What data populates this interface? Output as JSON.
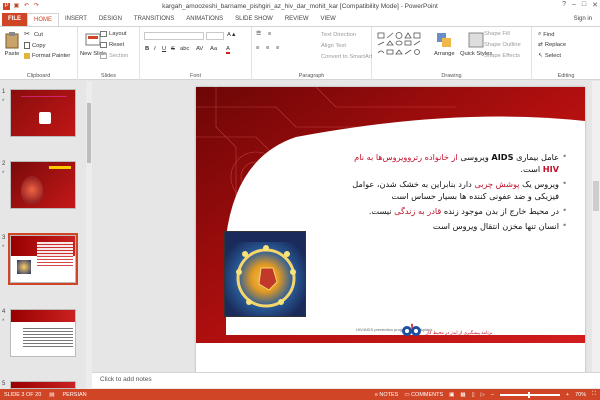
{
  "window": {
    "title": "kargah_amoozeshi_barname_pishgiri_az_hiv_dar_mohit_kar [Compatibility Mode] - PowerPoint",
    "signin": "Sign in"
  },
  "tabs": [
    "FILE",
    "HOME",
    "INSERT",
    "DESIGN",
    "TRANSITIONS",
    "ANIMATIONS",
    "SLIDE SHOW",
    "REVIEW",
    "VIEW"
  ],
  "ribbon": {
    "clipboard": {
      "label": "Clipboard",
      "paste": "Paste",
      "cut": "Cut",
      "copy": "Copy",
      "format_painter": "Format Painter"
    },
    "slides": {
      "label": "Slides",
      "new_slide": "New Slide",
      "layout": "Layout",
      "reset": "Reset",
      "section": "Section"
    },
    "font": {
      "label": "Font",
      "bold": "B",
      "italic": "I",
      "underline": "U",
      "strike": "S",
      "shadow": "abc",
      "spacing": "AV",
      "case": "Aa"
    },
    "paragraph": {
      "label": "Paragraph",
      "text_direction": "Text Direction",
      "align_text": "Align Text",
      "convert": "Convert to SmartArt"
    },
    "drawing": {
      "label": "Drawing",
      "arrange": "Arrange",
      "quick_styles": "Quick Styles",
      "shape_fill": "Shape Fill",
      "shape_outline": "Shape Outline",
      "shape_effects": "Shape Effects"
    },
    "editing": {
      "label": "Editing",
      "find": "Find",
      "replace": "Replace",
      "select": "Select"
    }
  },
  "thumbnails": [
    {
      "num": "1",
      "star": "*"
    },
    {
      "num": "2",
      "star": "*"
    },
    {
      "num": "3",
      "star": "*"
    },
    {
      "num": "4",
      "star": "*"
    },
    {
      "num": "5",
      "star": ""
    }
  ],
  "slide": {
    "bullet1_a": "عامل بیماری",
    "bullet1_aids": "AIDS",
    "bullet1_b": "ویروسی",
    "bullet1_red": "از خانواده رتروویروس‌ها به نام",
    "bullet1_hiv": "HIV",
    "bullet1_c": "است.",
    "bullet2_a": "ویروس یک",
    "bullet2_red": "پوشش چربی",
    "bullet2_b": "دارد بنابراین به خشک شدن، عوامل فیزیکی و ضد عفونی کننده ها بسیار حساس است",
    "bullet3_a": "در محیط خارج از بدن موجود زنده",
    "bullet3_red": "قادر به زندگی",
    "bullet3_b": "نیست.",
    "bullet4": "انسان تنها مخزن انتقال ویروس است",
    "footer_text": "برنامه پیشگیری از ایدز در محیط کار",
    "footer_logo": "HIV/AIDS prevention program at workplace"
  },
  "notes_placeholder": "Click to add notes",
  "status": {
    "slide_of": "SLIDE 3 OF 20",
    "language": "PERSIAN",
    "notes": "NOTES",
    "comments": "COMMENTS",
    "zoom": "70%"
  }
}
